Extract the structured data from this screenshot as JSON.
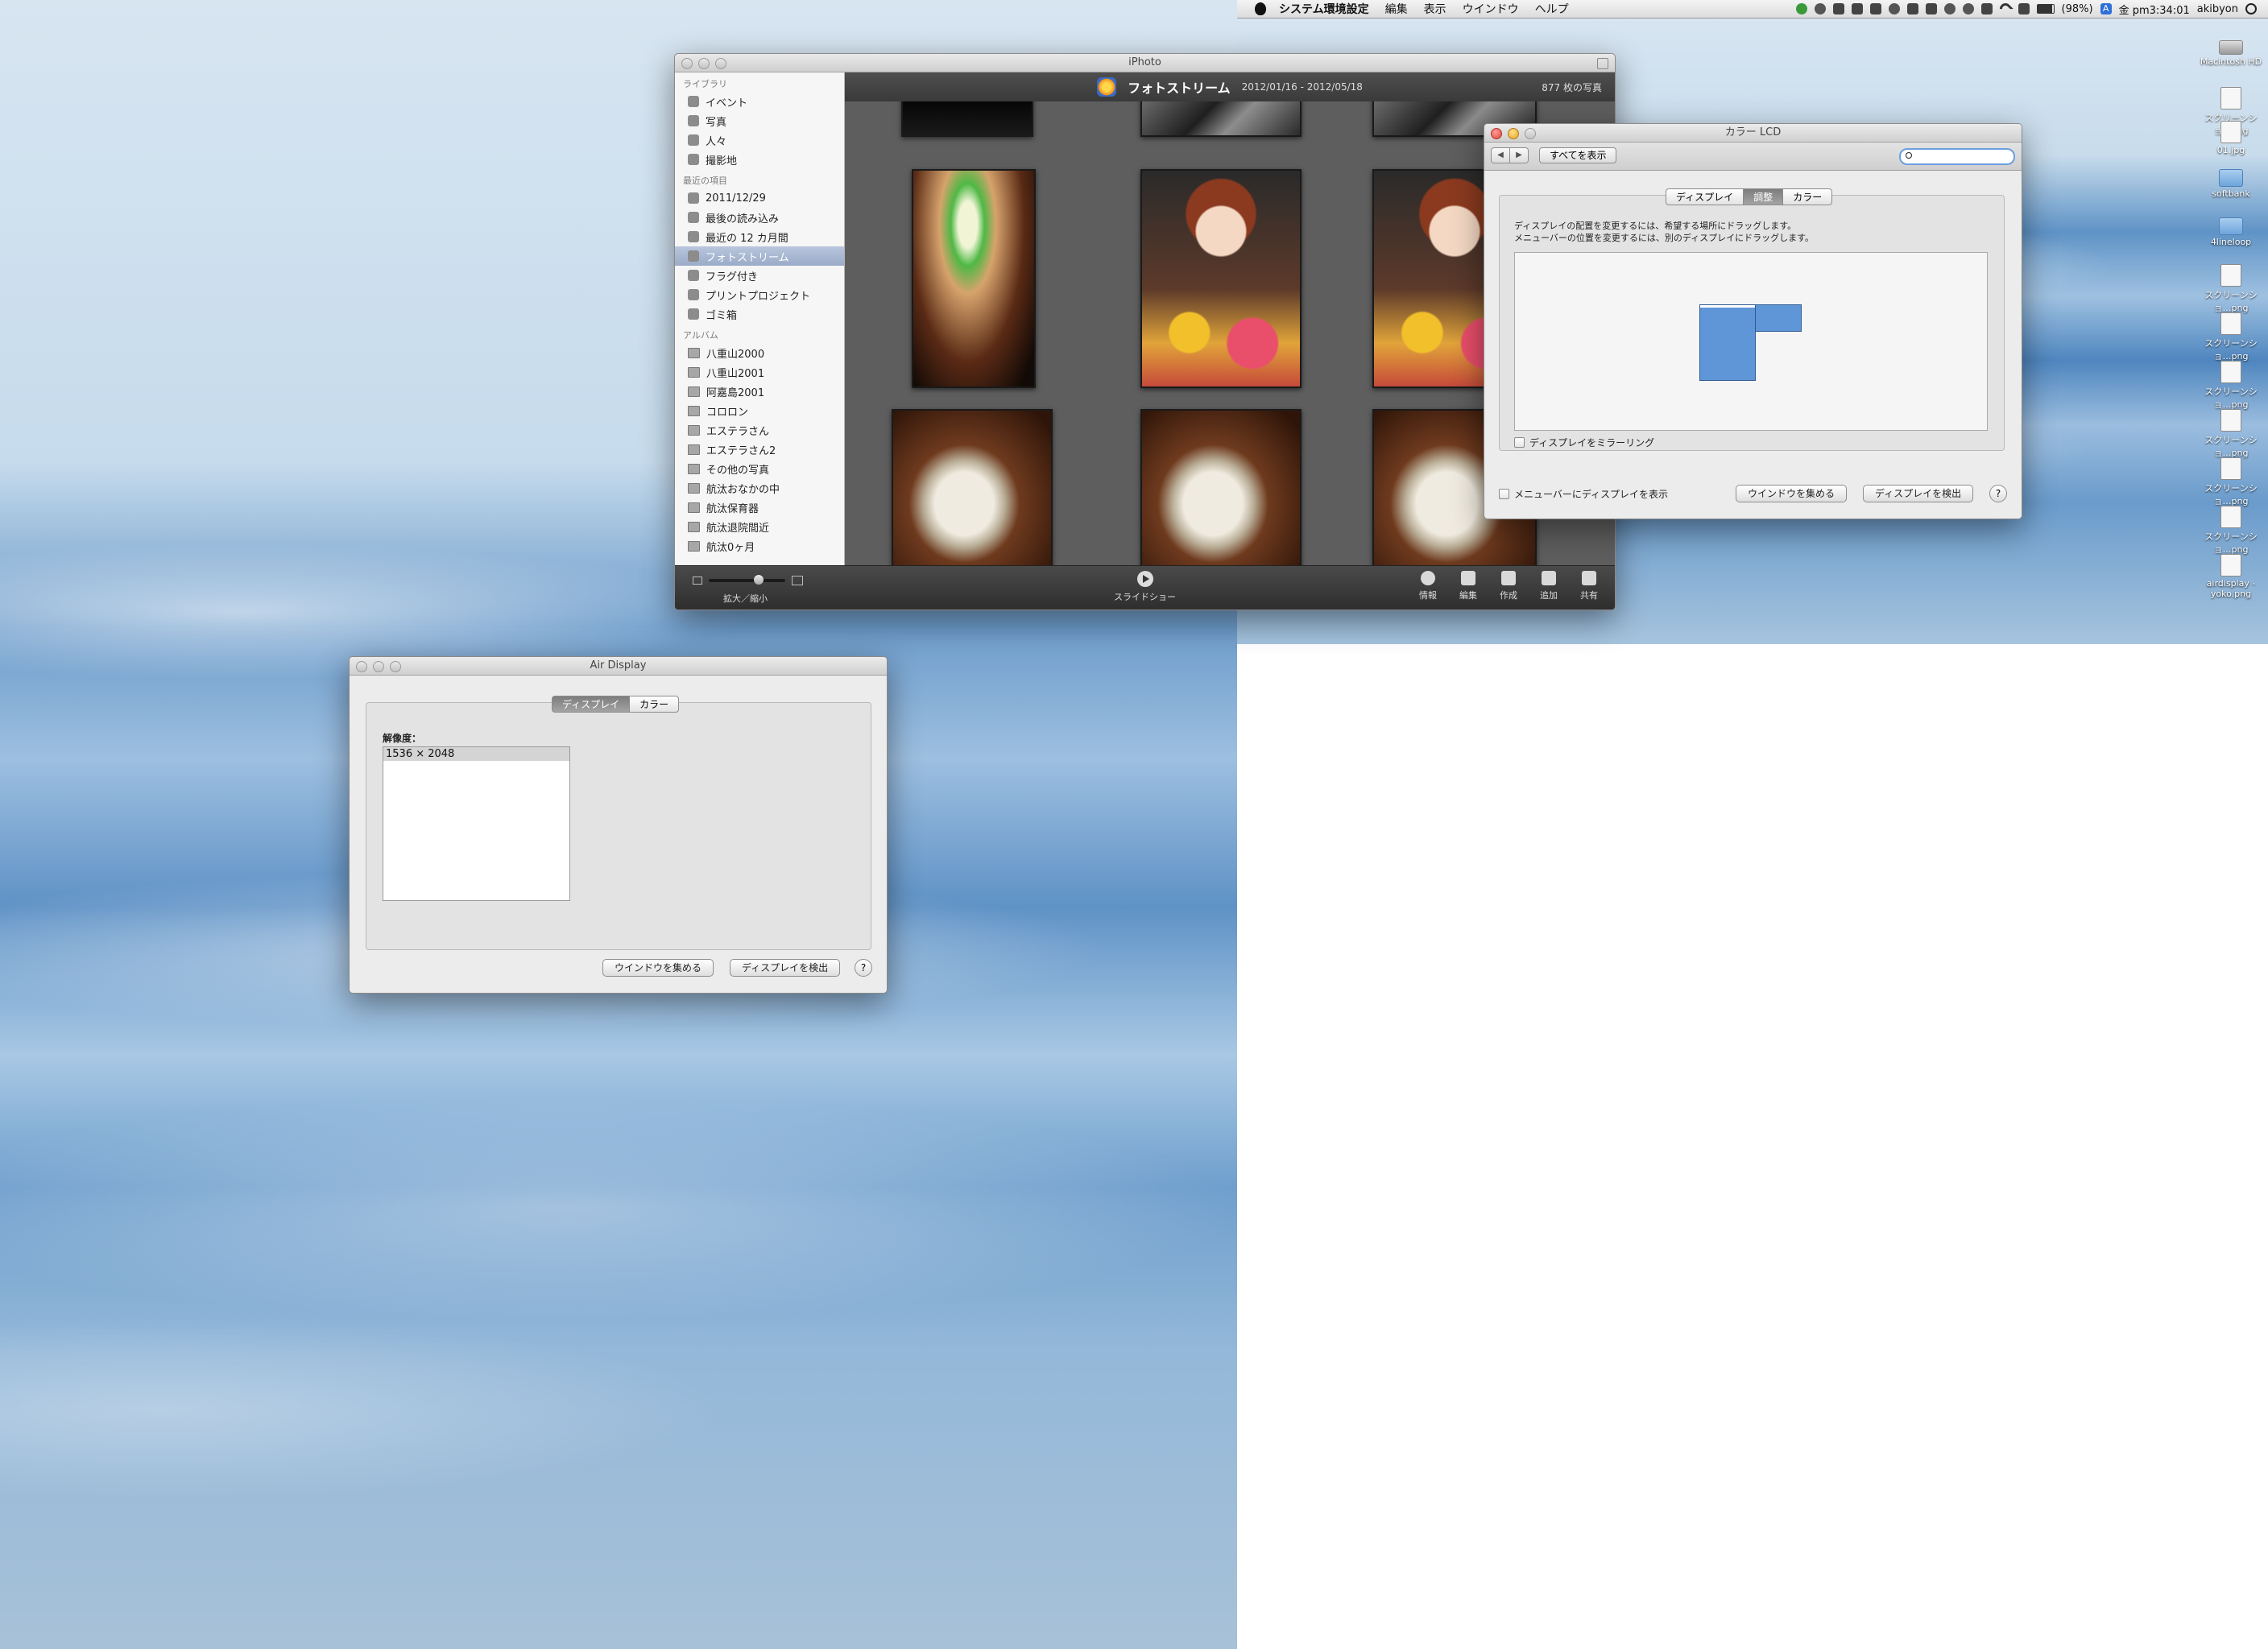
{
  "menubar": {
    "app": "システム環境設定",
    "items": [
      "編集",
      "表示",
      "ウインドウ",
      "ヘルプ"
    ],
    "battery": "(98%)",
    "input_mode": "A",
    "clock": "金 pm3:34:01",
    "user": "akibyon"
  },
  "desktop_icons": [
    {
      "label": "Macintosh HD",
      "icon": "hard-drive-icon"
    },
    {
      "label": "スクリーンショ…png",
      "icon": "file-icon"
    },
    {
      "label": "01.jpg",
      "icon": "file-icon"
    },
    {
      "label": "softbank",
      "icon": "folder-icon"
    },
    {
      "label": "4lineloop",
      "icon": "folder-icon"
    },
    {
      "label": "スクリーンショ…png",
      "icon": "file-icon"
    },
    {
      "label": "スクリーンショ…png",
      "icon": "file-icon"
    },
    {
      "label": "スクリーンショ…png",
      "icon": "file-icon"
    },
    {
      "label": "スクリーンショ…png",
      "icon": "file-icon"
    },
    {
      "label": "スクリーンショ…png",
      "icon": "file-icon"
    },
    {
      "label": "スクリーンショ…png",
      "icon": "file-icon"
    },
    {
      "label": "airdisplay -yoko.png",
      "icon": "file-icon"
    }
  ],
  "iphoto": {
    "window_title": "iPhoto",
    "sidebar": {
      "library_heading": "ライブラリ",
      "library": [
        "イベント",
        "写真",
        "人々",
        "撮影地"
      ],
      "recent_heading": "最近の項目",
      "recent": [
        "2011/12/29",
        "最後の読み込み",
        "最近の 12 カ月間",
        "フォトストリーム",
        "フラグ付き",
        "プリントプロジェクト",
        "ゴミ箱"
      ],
      "selected": "フォトストリーム",
      "albums_heading": "アルバム",
      "albums": [
        "八重山2000",
        "八重山2001",
        "阿嘉島2001",
        "コロロン",
        "エステラさん",
        "エステラさん2",
        "その他の写真",
        "航汰おなかの中",
        "航汰保育器",
        "航汰退院間近",
        "航汰0ヶ月"
      ]
    },
    "header": {
      "title": "フォトストリーム",
      "dates": "2012/01/16 - 2012/05/18",
      "count": "877 枚の写真"
    },
    "toolbar": {
      "zoom_label": "拡大／縮小",
      "slideshow_label": "スライドショー",
      "tools": [
        {
          "label": "情報",
          "icon": "info-icon"
        },
        {
          "label": "編集",
          "icon": "pencil-icon"
        },
        {
          "label": "作成",
          "icon": "create-icon"
        },
        {
          "label": "追加",
          "icon": "plus-icon"
        },
        {
          "label": "共有",
          "icon": "share-icon"
        }
      ]
    }
  },
  "color_lcd": {
    "window_title": "カラー LCD",
    "show_all": "すべてを表示",
    "tabs": [
      "ディスプレイ",
      "調整",
      "カラー"
    ],
    "active_tab": "調整",
    "instruction_1": "ディスプレイの配置を変更するには、希望する場所にドラッグします。",
    "instruction_2": "メニューバーの位置を変更するには、別のディスプレイにドラッグします。",
    "mirror_label": "ディスプレイをミラーリング",
    "show_menubar_label": "メニューバーにディスプレイを表示",
    "gather_button": "ウインドウを集める",
    "detect_button": "ディスプレイを検出",
    "help": "?"
  },
  "air_display": {
    "window_title": "Air Display",
    "tabs": [
      "ディスプレイ",
      "カラー"
    ],
    "active_tab": "ディスプレイ",
    "resolution_label": "解像度：",
    "resolutions": [
      "1536 × 2048"
    ],
    "gather_button": "ウインドウを集める",
    "detect_button": "ディスプレイを検出",
    "help": "?"
  }
}
